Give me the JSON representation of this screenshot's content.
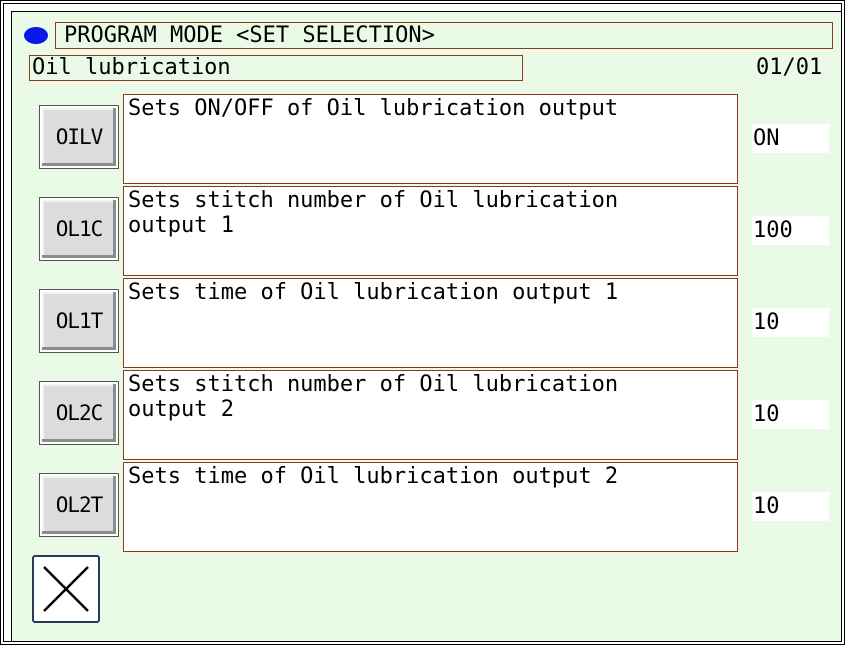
{
  "header": {
    "title": "PROGRAM MODE <SET SELECTION>",
    "category": "Oil lubrication",
    "page": "01/01",
    "status_indicator_color": "#0a18e8"
  },
  "params": [
    {
      "code": "OILV",
      "description": "Sets ON/OFF of Oil lubrication output",
      "value": "ON"
    },
    {
      "code": "OL1C",
      "description": "Sets stitch number of Oil lubrication\noutput 1",
      "value": "100"
    },
    {
      "code": "OL1T",
      "description": "Sets time of Oil lubrication output 1",
      "value": "10"
    },
    {
      "code": "OL2C",
      "description": "Sets stitch number of Oil lubrication\noutput 2",
      "value": "10"
    },
    {
      "code": "OL2T",
      "description": "Sets time of Oil lubrication output 2",
      "value": "10"
    }
  ],
  "footer": {
    "close_icon": "close-icon"
  },
  "colors": {
    "background": "#e9fbe6",
    "border_accent": "#8b3a1f"
  }
}
